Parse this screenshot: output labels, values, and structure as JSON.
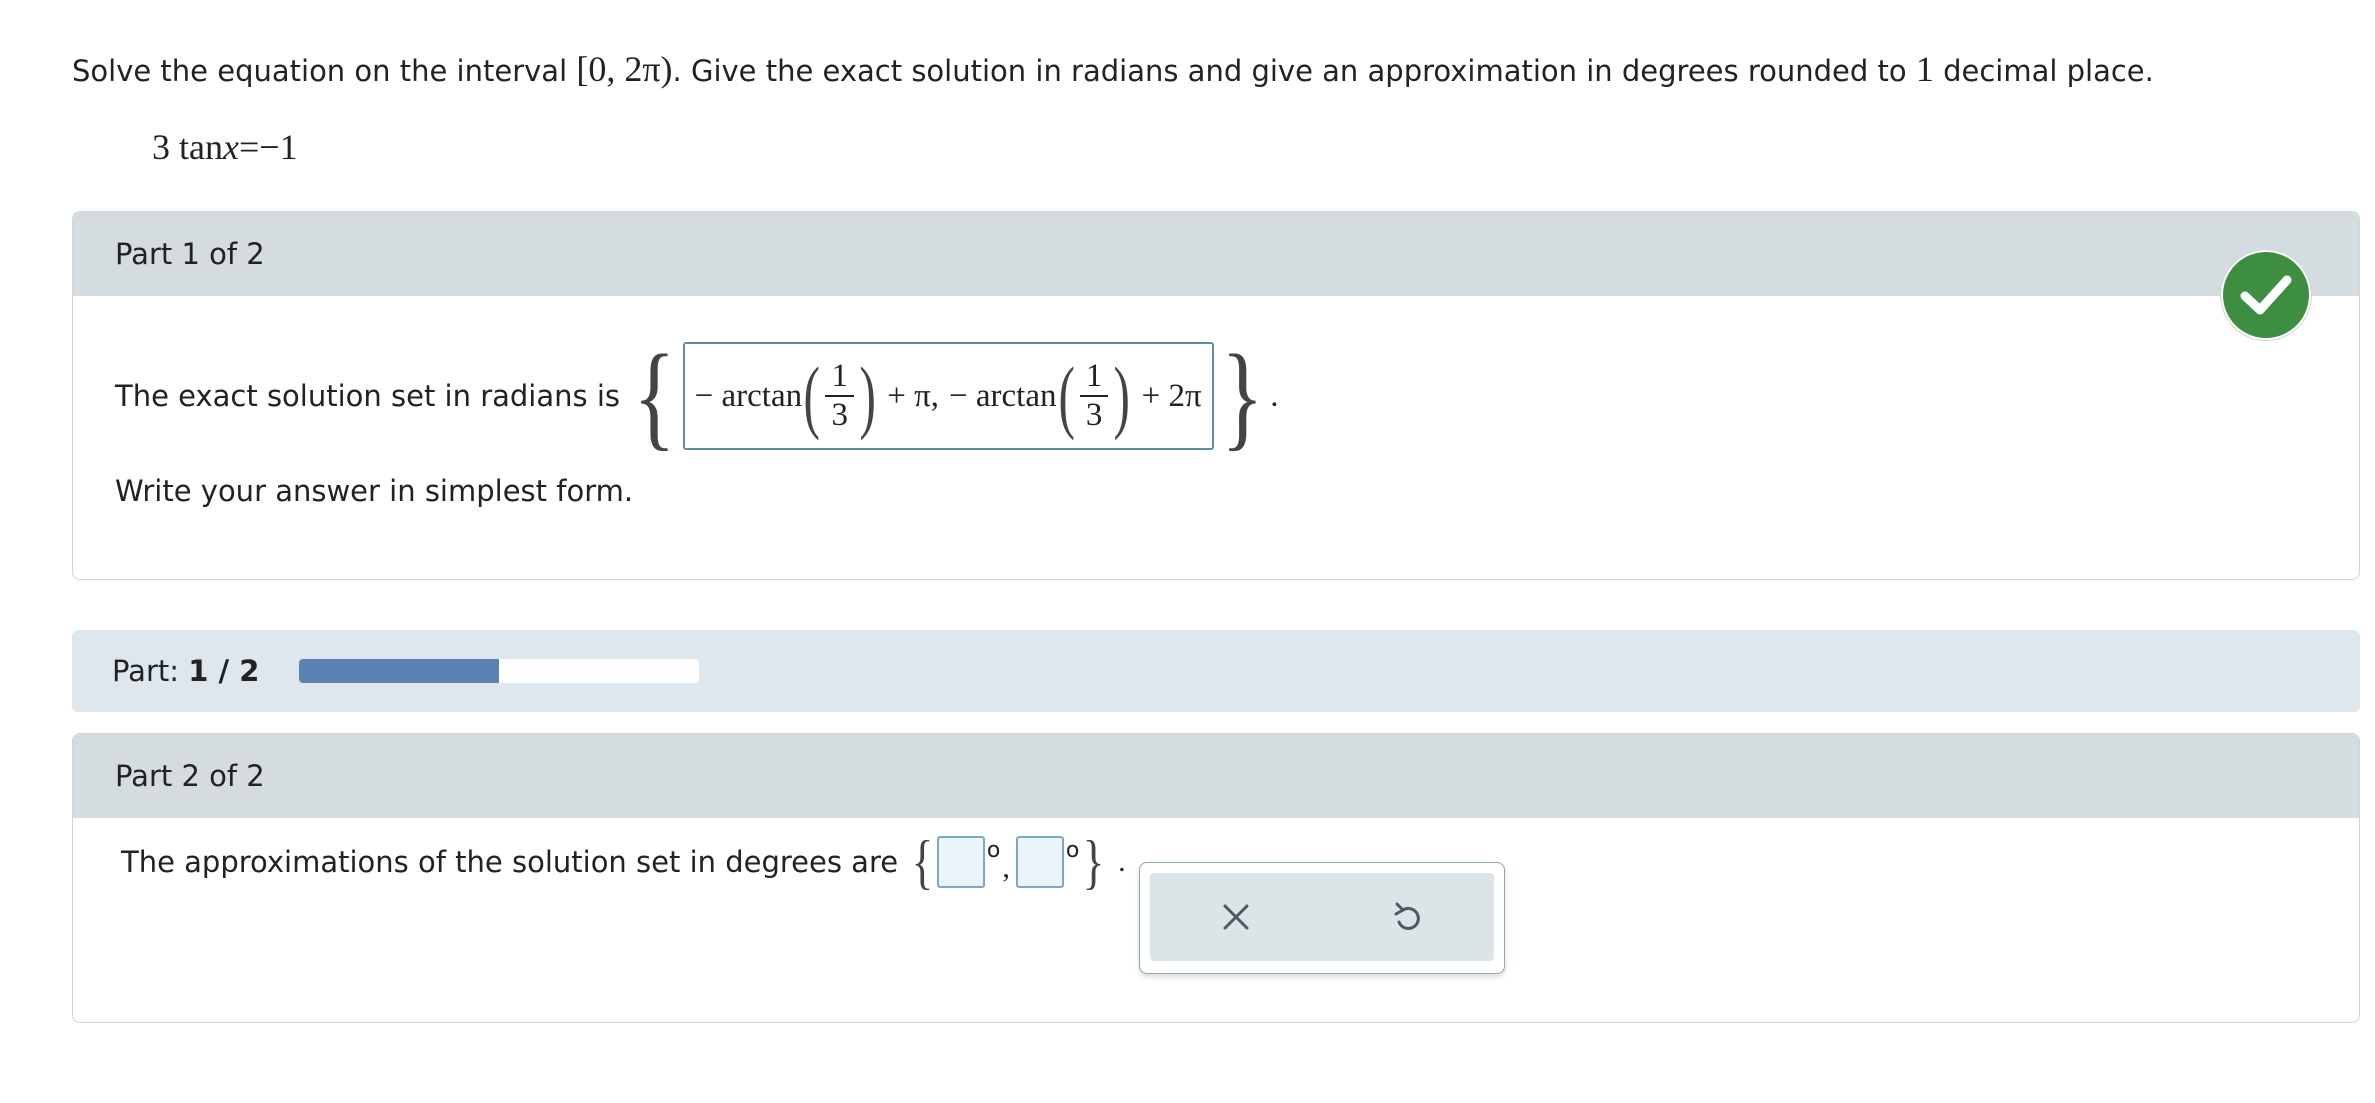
{
  "prompt": {
    "text_a": "Solve the equation on the interval ",
    "interval_open": "[",
    "interval_a": "0",
    "interval_sep": ", ",
    "interval_b": "2π",
    "interval_close": ")",
    "text_b": ". Give the exact solution in radians and give an approximation in degrees rounded to ",
    "decimal_count": "1",
    "text_c": " decimal place."
  },
  "equation": {
    "coef": "3",
    "func": "tan",
    "var": "x",
    "rhs": "=−1"
  },
  "part1": {
    "header": "Part 1 of 2",
    "sentence": "The exact solution set in radians is",
    "answer": {
      "neg1": "− arctan",
      "num1": "1",
      "den1": "3",
      "plus1": "+ π,",
      "neg2": "− arctan",
      "num2": "1",
      "den2": "3",
      "plus2": "+ 2π"
    },
    "period": ".",
    "instruction": "Write your answer in simplest form.",
    "status": "correct",
    "status_color": "#3e8e41"
  },
  "progress": {
    "label": "Part: ",
    "value": "1 / 2",
    "fraction": 0.5,
    "fill_color": "#5a82b3"
  },
  "part2": {
    "header": "Part 2 of 2",
    "sentence": "The approximations of the solution set in degrees are",
    "degree_symbol": "o",
    "comma": ",",
    "period": ".",
    "inputs": [
      "",
      ""
    ]
  },
  "tools": {
    "clear_icon": "close-icon",
    "undo_icon": "undo-icon"
  }
}
